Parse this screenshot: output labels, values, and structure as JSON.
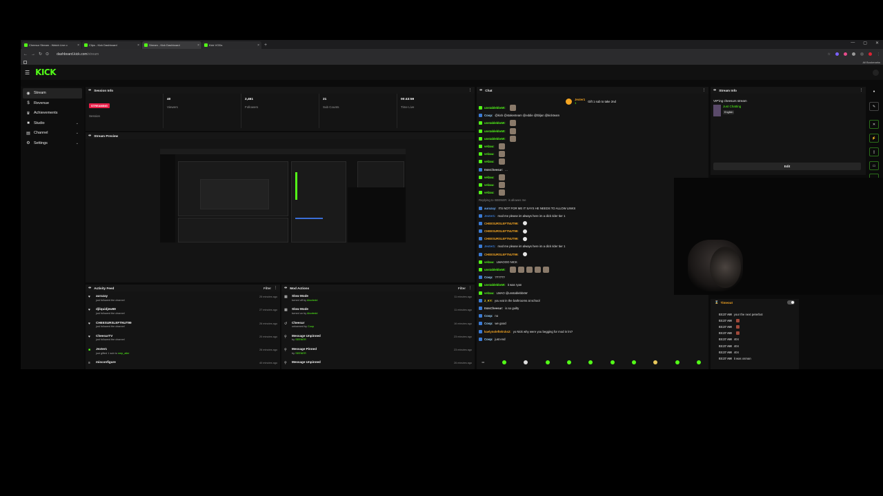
{
  "browser": {
    "tabs": [
      {
        "title": "Cheesur Stream - Watch Live o"
      },
      {
        "title": "Clips - Kick Dashboard"
      },
      {
        "title": "Stream - Kick Dashboard"
      },
      {
        "title": "Kick VODs"
      }
    ],
    "url_host": "dashboard.kick.com",
    "url_path": "/stream",
    "all_bookmarks": "All Bookmarks",
    "tab_close": "×",
    "new_tab": "+",
    "window_controls": [
      "—",
      "▢",
      "✕"
    ]
  },
  "app": {
    "logo": "KICK"
  },
  "sidebar": {
    "items": [
      {
        "label": "Stream",
        "icon": "broadcast-icon"
      },
      {
        "label": "Revenue",
        "icon": "dollar-icon"
      },
      {
        "label": "Achievements",
        "icon": "trophy-icon"
      },
      {
        "label": "Studio",
        "icon": "studio-icon"
      },
      {
        "label": "Channel",
        "icon": "channel-icon"
      },
      {
        "label": "Settings",
        "icon": "gear-icon"
      }
    ]
  },
  "session": {
    "title": "Session Info",
    "status": "STREAMING",
    "status_label": "Session",
    "viewers": "40",
    "viewers_label": "Viewers",
    "followers": "2,461",
    "followers_label": "Followers",
    "subs": "21",
    "subs_label": "Sub Counts",
    "time": "00:43:59",
    "time_label": "Time Live"
  },
  "preview": {
    "title": "Stream Preview"
  },
  "activity": {
    "title": "Activity Feed",
    "filter": "Filter",
    "items": [
      {
        "name": "aurazay",
        "sub": "just followed the channel",
        "time": "25 minutes ago"
      },
      {
        "name": "djliquidjew69",
        "sub": "just followed the channel",
        "time": "27 minutes ago"
      },
      {
        "name": "CHEESURSLEFTNUT99",
        "sub": "just followed the channel",
        "time": "26 minutes ago"
      },
      {
        "name": "CheesurTV",
        "sub": "just followed the channel",
        "time": "20 minutes ago"
      },
      {
        "name": "Jexter1",
        "sub": "just gifted 1 sub to",
        "hl": "mep_aller",
        "time": "26 minutes ago"
      },
      {
        "name": "misconfigure",
        "sub": "",
        "time": "40 minutes ago"
      }
    ]
  },
  "mod": {
    "title": "Mod Actions",
    "filter": "Filter",
    "items": [
      {
        "name": "Slow Mode",
        "sub": "turned off by",
        "hl": "Abortedd",
        "time": "11 minutes ago"
      },
      {
        "name": "Slow Mode",
        "sub": "turned on by",
        "hl": "Abortedd",
        "time": "11 minutes ago"
      },
      {
        "name": "Cheesur",
        "sub": "unbanned by",
        "hl": "Coop",
        "time": "16 minutes ago"
      },
      {
        "name": "Message Unpinned",
        "sub": "by",
        "hl": "SEENER",
        "time": "23 minutes ago"
      },
      {
        "name": "Message Pinned",
        "sub": "by",
        "hl": "SEENER",
        "time": "23 minutes ago"
      },
      {
        "name": "Message Unpinned",
        "sub": "",
        "hl": "",
        "time": "26 minutes ago"
      }
    ]
  },
  "chat": {
    "title": "Chat",
    "pinned_user": "Jexter1",
    "pinned_count": "1",
    "pinned_text": "Gift 1 sub to take 2nd",
    "lines": [
      {
        "user": "unstablebbsW:",
        "color": "#53fc18",
        "text": "",
        "emotes": 1
      },
      {
        "user": "Coop:",
        "color": "#9fd6ff",
        "text": "@kick @stakesteam @eddie @tbljan @kickteam",
        "emotes": 0
      },
      {
        "user": "unstablebbsW:",
        "color": "#53fc18",
        "text": "",
        "emotes": 1
      },
      {
        "user": "unstablebbsW:",
        "color": "#53fc18",
        "text": "",
        "emotes": 1
      },
      {
        "user": "unstablebbsW:",
        "color": "#53fc18",
        "text": "",
        "emotes": 1
      },
      {
        "user": "velzau:",
        "color": "#53fc18",
        "text": "",
        "emotes": 1
      },
      {
        "user": "velzau:",
        "color": "#53fc18",
        "text": "",
        "emotes": 1
      },
      {
        "user": "velzau:",
        "color": "#53fc18",
        "text": "",
        "emotes": 1
      },
      {
        "user": "ItsIsCheesur:",
        "color": "#d0d0d0",
        "text": "...",
        "emotes": 0
      },
      {
        "user": "velzau:",
        "color": "#53fc18",
        "text": "",
        "emotes": 1
      },
      {
        "user": "velzau:",
        "color": "#53fc18",
        "text": "",
        "emotes": 1
      },
      {
        "user": "velzau:",
        "color": "#53fc18",
        "text": "",
        "emotes": 1
      },
      {
        "user": "",
        "color": "#8a8a8a",
        "text": "Replying to SEENER: is allowes me",
        "emotes": 0
      },
      {
        "user": "aurazay:",
        "color": "#6fb0ff",
        "text": "ITS NOT FOR ME IT SAYS HE NEEDS TO ALLOW LINKS",
        "emotes": 0
      },
      {
        "user": "Jexter1:",
        "color": "#3a7bd5",
        "text": "mod me please im always here im a dick rider tier 1",
        "emotes": 0
      },
      {
        "user": "CHEESURSLEFTNUT99:",
        "color": "#f5a623",
        "text": "",
        "emotes": 1
      },
      {
        "user": "CHEESURSLEFTNUT99:",
        "color": "#f5a623",
        "text": "",
        "emotes": 1
      },
      {
        "user": "CHEESURSLEFTNUT99:",
        "color": "#f5a623",
        "text": "",
        "emotes": 1
      },
      {
        "user": "Jexter1:",
        "color": "#3a7bd5",
        "text": "mod me please im always here im a dick rider tier 1",
        "emotes": 0
      },
      {
        "user": "CHEESURSLEFTNUT99:",
        "color": "#f5a623",
        "text": "",
        "emotes": 1
      },
      {
        "user": "velzau:",
        "color": "#53fc18",
        "text": "LMAOOO NICK",
        "emotes": 0
      },
      {
        "user": "unstablebbsW:",
        "color": "#53fc18",
        "text": "",
        "emotes": 5
      },
      {
        "user": "Coop:",
        "color": "#9fd6ff",
        "text": "??????",
        "emotes": 0
      },
      {
        "user": "unstablebbsW:",
        "color": "#53fc18",
        "text": "it was ryan",
        "emotes": 0
      },
      {
        "user": "velzau:",
        "color": "#53fc18",
        "text": "LMAO @unstablebbsW",
        "emotes": 0
      },
      {
        "user": "2_KY:",
        "color": "#f5d423",
        "text": "you eat in the bathrooms at school",
        "emotes": 0
      },
      {
        "user": "ItsIsCheesur:",
        "color": "#d0d0d0",
        "text": "is so guilty",
        "emotes": 0
      },
      {
        "user": "Coop:",
        "color": "#9fd6ff",
        "text": "no",
        "emotes": 0
      },
      {
        "user": "Coop:",
        "color": "#9fd6ff",
        "text": "we good",
        "emotes": 0
      },
      {
        "user": "kaelynoleftelrcks2:",
        "color": "#f5a623",
        "text": "yo Nick why were you begging for mod in lrs?",
        "emotes": 0
      },
      {
        "user": "Coop:",
        "color": "#9fd6ff",
        "text": "just end",
        "emotes": 0
      }
    ]
  },
  "stream_info": {
    "title": "Stream Info",
    "stream_title": "VIP'ing cheesurs stream",
    "category": "Just Chatting",
    "language": "English",
    "edit": "Edit"
  },
  "timeout": {
    "label": "Timeout",
    "lines": [
      {
        "time": "03:27 AM",
        "text": "your the next peterbot",
        "emote": false
      },
      {
        "time": "03:27 AM",
        "text": "",
        "emote": true
      },
      {
        "time": "03:27 AM",
        "text": "",
        "emote": true
      },
      {
        "time": "03:27 AM",
        "text": "",
        "emote": true
      },
      {
        "time": "03:27 AM",
        "text": "404",
        "emote": false
      },
      {
        "time": "03:27 AM",
        "text": "404",
        "emote": false
      },
      {
        "time": "03:27 AM",
        "text": "404",
        "emote": false
      },
      {
        "time": "03:27 AM",
        "text": "it was osman",
        "emote": false
      }
    ]
  }
}
